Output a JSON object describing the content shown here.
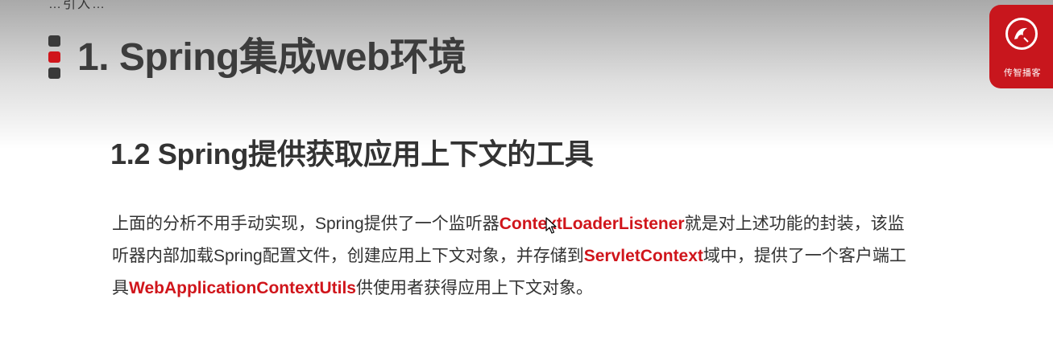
{
  "header": {
    "top_fragment": "…引入…",
    "title": "1. Spring集成web环境"
  },
  "logo": {
    "icon": "logo-emblem-icon",
    "text": "传智播客",
    "color": "#c8161d"
  },
  "section": {
    "subtitle": "1.2 Spring提供获取应用上下文的工具"
  },
  "paragraph": {
    "l1_a": "上面的分析不用手动实现，Spring提供了一个监听器",
    "l1_b": "ContextLoaderListener",
    "l1_c": "就是对上述功能的封装，该监",
    "l2_a": "听器内部加载Spring配置文件，创建应用上下文对象，并存储到",
    "l2_b": "ServletContext",
    "l2_c": "域中，提供了一个客户端工",
    "l3_a": "具",
    "l3_b": "WebApplicationContextUtils",
    "l3_c": "供使用者获得应用上下文对象。"
  },
  "colors": {
    "accent": "#d0151b",
    "title_text": "#3c3c3c",
    "body_text": "#333333"
  },
  "cursor": {
    "icon": "mouse-pointer-icon"
  }
}
